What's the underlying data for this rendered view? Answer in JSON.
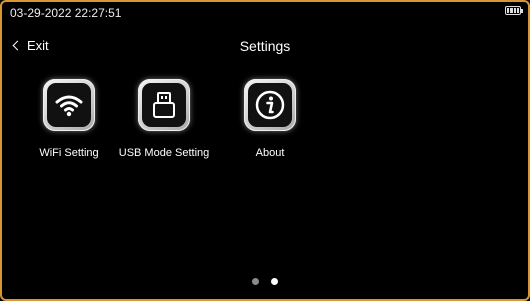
{
  "status": {
    "datetime": "03-29-2022 22:27:51",
    "battery_icon": "battery-full-icon"
  },
  "nav": {
    "back_label": "Exit",
    "back_icon": "chevron-left-icon",
    "title": "Settings"
  },
  "tiles": [
    {
      "label": "WiFi Setting",
      "icon": "wifi-icon"
    },
    {
      "label": "USB Mode Setting",
      "icon": "usb-icon"
    },
    {
      "label": "About",
      "icon": "info-icon"
    }
  ],
  "pager": {
    "page_count": 2,
    "current_page": 2,
    "active_color": "#ffffff",
    "inactive_color": "#8a8a8a"
  }
}
